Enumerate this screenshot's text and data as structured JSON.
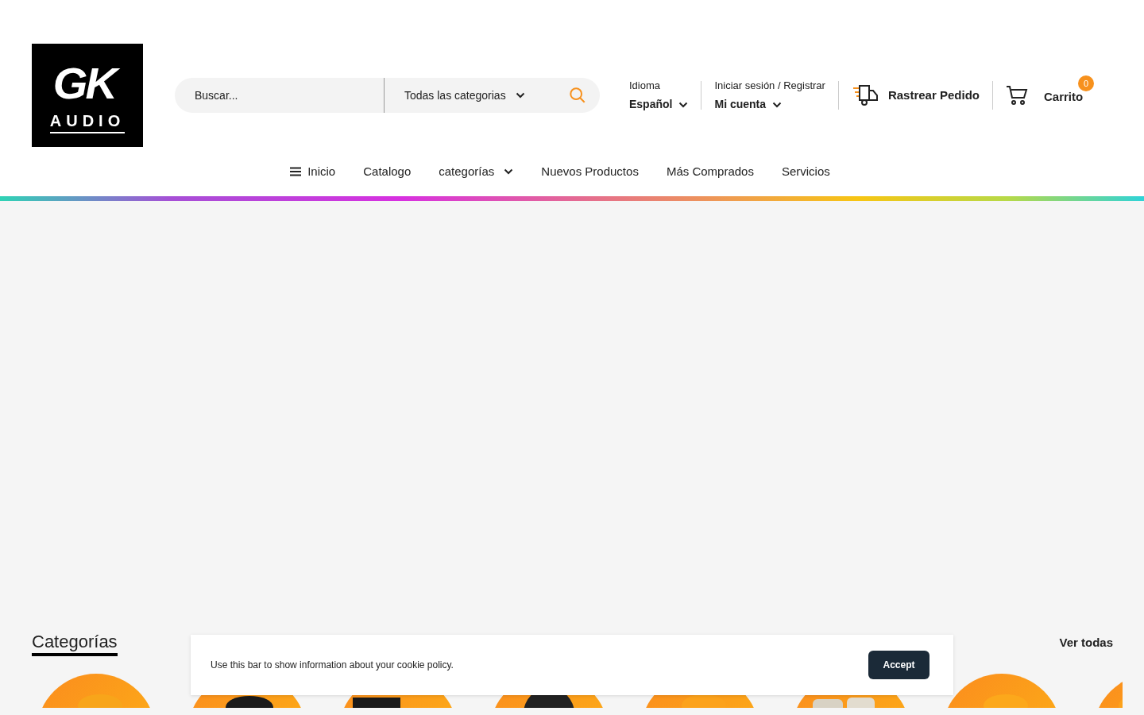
{
  "logo": {
    "text": "GK",
    "subtitle": "AUDIO"
  },
  "search": {
    "placeholder": "Buscar...",
    "category": "Todas las categorias"
  },
  "language": {
    "label": "Idioma",
    "value": "Español"
  },
  "account": {
    "label": "Iniciar sesión / Registrar",
    "value": "Mi cuenta"
  },
  "track_order": "Rastrear Pedido",
  "cart": {
    "label": "Carrito",
    "count": "0"
  },
  "nav": [
    {
      "label": "Inicio",
      "kind": "menu"
    },
    {
      "label": "Catalogo",
      "kind": "link"
    },
    {
      "label": "categorías",
      "kind": "dropdown"
    },
    {
      "label": "Nuevos Productos",
      "kind": "link"
    },
    {
      "label": "Más Comprados",
      "kind": "link"
    },
    {
      "label": "Servicios",
      "kind": "link"
    }
  ],
  "categories": {
    "title": "Categorías",
    "view_all": "Ver todas"
  },
  "cookie_bar": {
    "text": "Use this bar to show information about your cookie policy.",
    "button": "Accept"
  }
}
